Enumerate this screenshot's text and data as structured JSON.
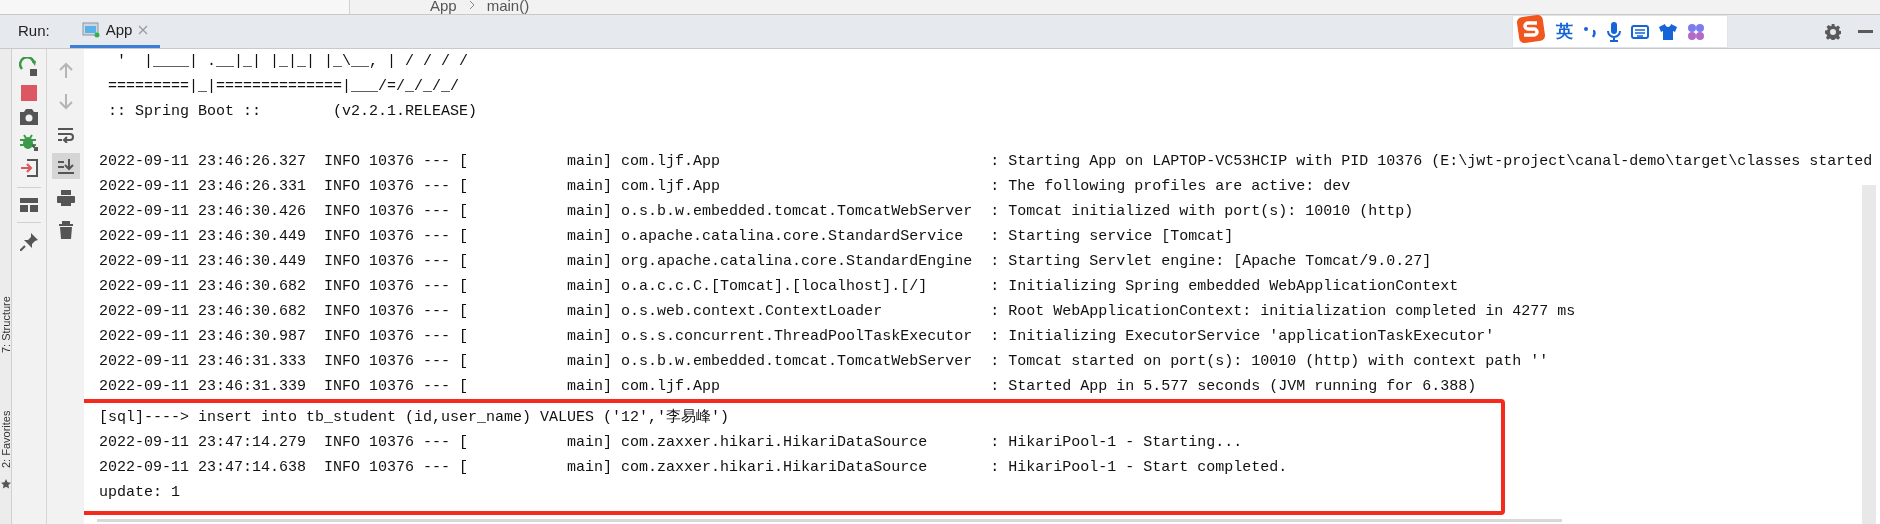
{
  "editor_breadcrumb": [
    "App",
    "main()"
  ],
  "run_bar": {
    "label": "Run:",
    "tabs": [
      {
        "label": "App",
        "selected": true
      }
    ]
  },
  "ime_toolbar": {
    "language": "英"
  },
  "side_tool_windows": [
    "7: Structure",
    "2: Favorites"
  ],
  "console_tools": [
    {
      "kind": "up",
      "disabled": true,
      "on": false
    },
    {
      "kind": "down",
      "disabled": true,
      "on": false
    },
    {
      "kind": "soft-wrap",
      "disabled": false,
      "on": false
    },
    {
      "kind": "scroll-to-end",
      "disabled": false,
      "on": true
    },
    {
      "kind": "print",
      "disabled": false,
      "on": false
    },
    {
      "kind": "clear",
      "disabled": false,
      "on": false
    }
  ],
  "console": {
    "banner": [
      "  '  |____| .__|_| |_|_| |_\\__, | / / / /",
      " =========|_|==============|___/=/_/_/_/",
      " :: Spring Boot ::        (v2.2.1.RELEASE)"
    ],
    "lines": [
      "2022-09-11 23:46:26.327  INFO 10376 --- [           main] com.ljf.App                              : Starting App on LAPTOP-VC53HCIP with PID 10376 (E:\\jwt-project\\canal-demo\\target\\classes started",
      "2022-09-11 23:46:26.331  INFO 10376 --- [           main] com.ljf.App                              : The following profiles are active: dev",
      "2022-09-11 23:46:30.426  INFO 10376 --- [           main] o.s.b.w.embedded.tomcat.TomcatWebServer  : Tomcat initialized with port(s): 10010 (http)",
      "2022-09-11 23:46:30.449  INFO 10376 --- [           main] o.apache.catalina.core.StandardService   : Starting service [Tomcat]",
      "2022-09-11 23:46:30.449  INFO 10376 --- [           main] org.apache.catalina.core.StandardEngine  : Starting Servlet engine: [Apache Tomcat/9.0.27]",
      "2022-09-11 23:46:30.682  INFO 10376 --- [           main] o.a.c.c.C.[Tomcat].[localhost].[/]       : Initializing Spring embedded WebApplicationContext",
      "2022-09-11 23:46:30.682  INFO 10376 --- [           main] o.s.web.context.ContextLoader            : Root WebApplicationContext: initialization completed in 4277 ms",
      "2022-09-11 23:46:30.987  INFO 10376 --- [           main] o.s.s.concurrent.ThreadPoolTaskExecutor  : Initializing ExecutorService 'applicationTaskExecutor'",
      "2022-09-11 23:46:31.333  INFO 10376 --- [           main] o.s.b.w.embedded.tomcat.TomcatWebServer  : Tomcat started on port(s): 10010 (http) with context path ''",
      "2022-09-11 23:46:31.339  INFO 10376 --- [           main] com.ljf.App                              : Started App in 5.577 seconds (JVM running for 6.388)"
    ],
    "highlighted_lines": [
      "[sql]----> insert into tb_student (id,user_name) VALUES ('12','李易峰')",
      "2022-09-11 23:47:14.279  INFO 10376 --- [           main] com.zaxxer.hikari.HikariDataSource       : HikariPool-1 - Starting...",
      "2022-09-11 23:47:14.638  INFO 10376 --- [           main] com.zaxxer.hikari.HikariDataSource       : HikariPool-1 - Start completed.",
      "update: 1"
    ]
  }
}
